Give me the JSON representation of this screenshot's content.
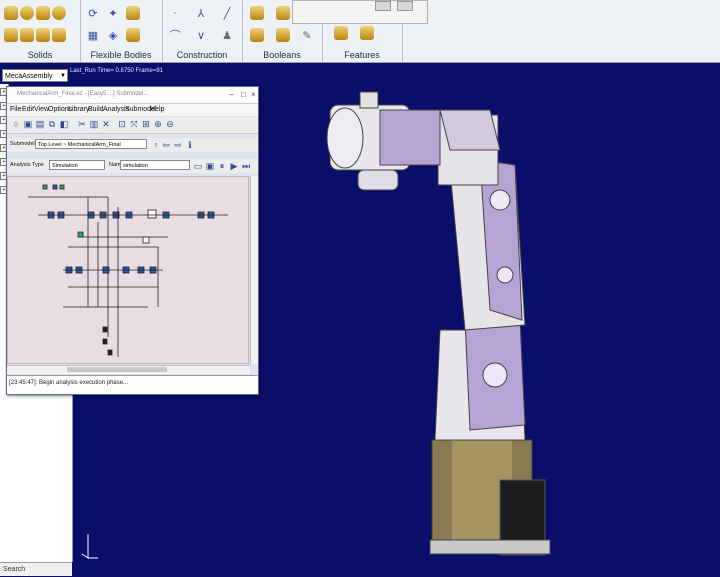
{
  "ribbon": {
    "groups": [
      {
        "label": "Solids"
      },
      {
        "label": "Flexible Bodies"
      },
      {
        "label": "Construction"
      },
      {
        "label": "Booleans"
      },
      {
        "label": "Features"
      }
    ]
  },
  "model_selector": {
    "value": "MecaAssembly"
  },
  "simulation_status": "Last_Run   Time= 0.8750  Frame=81",
  "search_label": "Search",
  "easy5_window": {
    "title": "MechanicalArm_Final.ez - [Easy5 ...] Submodel...",
    "menu": [
      "File",
      "Edit",
      "View",
      "Options",
      "Library",
      "Build",
      "Analysis",
      "Submodel",
      "Help"
    ],
    "submodel_label": "Submodel",
    "submodel_value": "Top Level ~ MechanicalArm_Final",
    "analysis_type_label": "Analysis Type",
    "analysis_type_value": "Simulation",
    "name_label": "Name",
    "name_value": "simulation",
    "status_message": "[23:45:47]: Begin analysis execution phase..."
  }
}
